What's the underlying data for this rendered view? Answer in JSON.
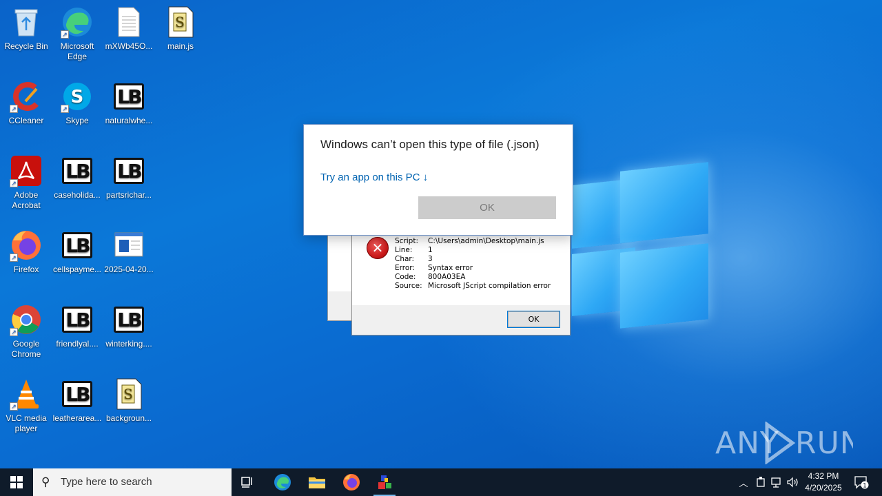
{
  "desktop": {
    "icons": [
      {
        "label": "Recycle Bin",
        "icon": "recycle-bin-icon"
      },
      {
        "label": "Microsoft Edge",
        "icon": "edge-icon"
      },
      {
        "label": "mXWb45O...",
        "icon": "text-file-icon"
      },
      {
        "label": "main.js",
        "icon": "script-file-icon"
      },
      {
        "label": "CCleaner",
        "icon": "ccleaner-icon"
      },
      {
        "label": "Skype",
        "icon": "skype-icon"
      },
      {
        "label": "naturalwhe...",
        "icon": "generic-file-icon"
      },
      {
        "label": "Adobe Acrobat",
        "icon": "acrobat-icon"
      },
      {
        "label": "caseholida...",
        "icon": "generic-file-icon"
      },
      {
        "label": "partsrichar...",
        "icon": "generic-file-icon"
      },
      {
        "label": "Firefox",
        "icon": "firefox-icon"
      },
      {
        "label": "cellspayme...",
        "icon": "generic-file-icon"
      },
      {
        "label": "2025-04-20...",
        "icon": "document-icon"
      },
      {
        "label": "Google Chrome",
        "icon": "chrome-icon"
      },
      {
        "label": "friendlyal....",
        "icon": "generic-file-icon"
      },
      {
        "label": "winterking....",
        "icon": "generic-file-icon"
      },
      {
        "label": "VLC media player",
        "icon": "vlc-icon"
      },
      {
        "label": "leatherarea...",
        "icon": "generic-file-icon"
      },
      {
        "label": "backgroun...",
        "icon": "script-file-icon"
      }
    ]
  },
  "open_with_dialog": {
    "title": "Windows can’t open this type of file (.json)",
    "link": "Try an app on this PC ↓",
    "ok_label": "OK"
  },
  "wsh_error": {
    "rows": [
      {
        "key": "Script:",
        "value": "C:\\Users\\admin\\Desktop\\main.js"
      },
      {
        "key": "Line:",
        "value": "1"
      },
      {
        "key": "Char:",
        "value": "3"
      },
      {
        "key": "Error:",
        "value": "Syntax error"
      },
      {
        "key": "Code:",
        "value": "800A03EA"
      },
      {
        "key": "Source:",
        "value": "Microsoft JScript compilation error"
      }
    ],
    "ok_label": "OK"
  },
  "watermark": "ANY RUN",
  "taskbar": {
    "search_placeholder": "Type here to search",
    "time": "4:32 PM",
    "date": "4/20/2025",
    "notification_count": "1"
  },
  "colors": {
    "link": "#0063b1",
    "taskbar": "#0f1b2a",
    "error_red": "#c81818"
  }
}
